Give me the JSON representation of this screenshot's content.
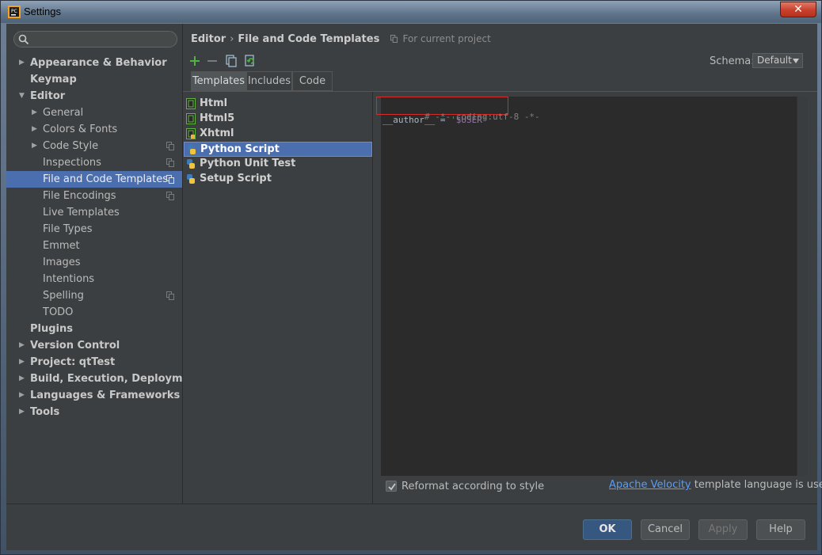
{
  "window": {
    "title": "Settings",
    "close_label": "✕"
  },
  "search": {
    "placeholder": ""
  },
  "sidebar": {
    "items": [
      {
        "label": "Appearance & Behavior"
      },
      {
        "label": "Keymap"
      },
      {
        "label": "Editor"
      },
      {
        "label": "General"
      },
      {
        "label": "Colors & Fonts"
      },
      {
        "label": "Code Style"
      },
      {
        "label": "Inspections"
      },
      {
        "label": "File and Code Templates"
      },
      {
        "label": "File Encodings"
      },
      {
        "label": "Live Templates"
      },
      {
        "label": "File Types"
      },
      {
        "label": "Emmet"
      },
      {
        "label": "Images"
      },
      {
        "label": "Intentions"
      },
      {
        "label": "Spelling"
      },
      {
        "label": "TODO"
      },
      {
        "label": "Plugins"
      },
      {
        "label": "Version Control"
      },
      {
        "label": "Project: qtTest"
      },
      {
        "label": "Build, Execution, Deployment"
      },
      {
        "label": "Languages & Frameworks"
      },
      {
        "label": "Tools"
      }
    ]
  },
  "breadcrumb": {
    "section": "Editor",
    "separator": "›",
    "page": "File and Code Templates",
    "scope": "For current project"
  },
  "schema": {
    "label": "Schema:",
    "value": "Default"
  },
  "tabs": [
    {
      "label": "Templates"
    },
    {
      "label": "Includes"
    },
    {
      "label": "Code"
    }
  ],
  "templates": [
    {
      "label": "Html"
    },
    {
      "label": "Html5"
    },
    {
      "label": "Xhtml"
    },
    {
      "label": "Python Script"
    },
    {
      "label": "Python Unit Test"
    },
    {
      "label": "Setup Script"
    }
  ],
  "editor": {
    "line1": "# -*- coding:utf-8 -*-",
    "line2_a": "__author__ = ",
    "line2_q1": "'",
    "line2_var": "$USER",
    "line2_q2": "'"
  },
  "reformat": {
    "label": "Reformat according to style",
    "checked": true
  },
  "velocity": {
    "link": "Apache Velocity",
    "rest": " template language is used"
  },
  "buttons": {
    "ok": "OK",
    "cancel": "Cancel",
    "apply": "Apply",
    "help": "Help"
  },
  "colors": {
    "selection": "#4b6eaf",
    "background": "#3c3f41",
    "editor_bg": "#2b2b2b",
    "highlight_box": "#d42b2b",
    "link": "#589df6"
  }
}
